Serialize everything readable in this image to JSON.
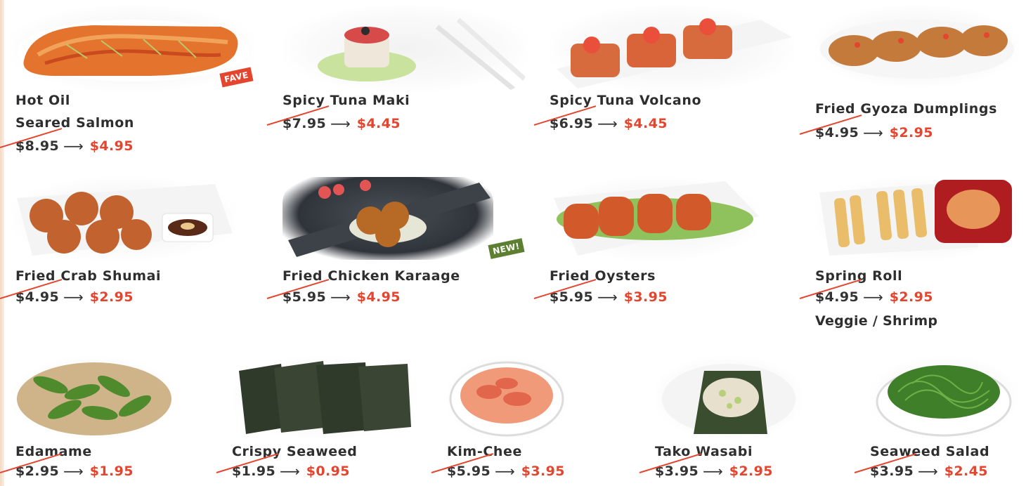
{
  "colors": {
    "sale_price": "#e4452f",
    "text": "#2e2e2e",
    "fave_badge": "#e4452f",
    "new_badge": "#5c7f31"
  },
  "items": [
    {
      "name_lines": [
        "Hot Oil",
        "Seared Salmon"
      ],
      "old_price": "$8.95",
      "new_price": "$4.95",
      "badge": "FAVE",
      "icon": "seared-salmon-photo"
    },
    {
      "name_lines": [
        "Spicy Tuna Maki"
      ],
      "old_price": "$7.95",
      "new_price": "$4.45",
      "icon": "tuna-maki-photo"
    },
    {
      "name_lines": [
        "Spicy Tuna Volcano"
      ],
      "old_price": "$6.95",
      "new_price": "$4.45",
      "icon": "tuna-volcano-photo"
    },
    {
      "name_lines": [
        "Fried Gyoza Dumplings"
      ],
      "old_price": "$4.95",
      "new_price": "$2.95",
      "icon": "gyoza-photo"
    },
    {
      "name_lines": [
        "Fried Crab Shumai"
      ],
      "old_price": "$4.95",
      "new_price": "$2.95",
      "icon": "shumai-photo"
    },
    {
      "name_lines": [
        "Fried Chicken Karaage"
      ],
      "old_price": "$5.95",
      "new_price": "$4.95",
      "badge": "NEW!",
      "icon": "karaage-photo"
    },
    {
      "name_lines": [
        "Fried Oysters"
      ],
      "old_price": "$5.95",
      "new_price": "$3.95",
      "icon": "oysters-photo"
    },
    {
      "name_lines": [
        "Spring Roll"
      ],
      "old_price": "$4.95",
      "new_price": "$2.95",
      "note": "Veggie / Shrimp",
      "icon": "spring-roll-photo"
    },
    {
      "name_lines": [
        "Edamame"
      ],
      "old_price": "$2.95",
      "new_price": "$1.95",
      "icon": "edamame-photo"
    },
    {
      "name_lines": [
        "Crispy Seaweed"
      ],
      "old_price": "$1.95",
      "new_price": "$0.95",
      "icon": "crispy-seaweed-photo"
    },
    {
      "name_lines": [
        "Kim-Chee"
      ],
      "old_price": "$5.95",
      "new_price": "$3.95",
      "icon": "kimchee-photo"
    },
    {
      "name_lines": [
        "Tako Wasabi"
      ],
      "old_price": "$3.95",
      "new_price": "$2.95",
      "icon": "tako-wasabi-photo"
    },
    {
      "name_lines": [
        "Seaweed Salad"
      ],
      "old_price": "$3.95",
      "new_price": "$2.45",
      "icon": "seaweed-salad-photo"
    }
  ],
  "arrow": "⟶"
}
